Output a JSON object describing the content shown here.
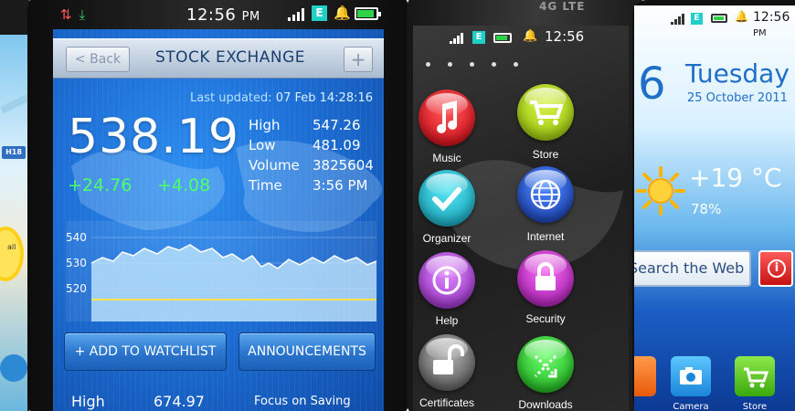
{
  "left_phone": {
    "map_badge": "H18",
    "map_fragment": "all"
  },
  "stock_app": {
    "status": {
      "time": "12:56",
      "period": "PM",
      "network_badge": "E"
    },
    "nav": {
      "back_label": "< Back",
      "title": "STOCK EXCHANGE",
      "add_label": "+"
    },
    "last_updated": {
      "label": "Last updated:",
      "value": "07 Feb 14:28:16"
    },
    "price": "538.19",
    "changes": [
      "+24.76",
      "+4.08"
    ],
    "stats": [
      {
        "key": "High",
        "value": "547.26"
      },
      {
        "key": "Low",
        "value": "481.09"
      },
      {
        "key": "Volume",
        "value": "3825604"
      },
      {
        "key": "Time",
        "value": "3:56 PM"
      }
    ],
    "chart": {
      "y_ticks": [
        "540",
        "530",
        "520"
      ],
      "line_color": "#ffe14a"
    },
    "buttons": {
      "watchlist": "+ ADD TO WATCHLIST",
      "announcements": "ANNOUNCEMENTS"
    },
    "bottom": {
      "high_label": "High",
      "high_value": "674.97",
      "news": "Focus on Saving"
    }
  },
  "icon_phone": {
    "brand": "4G LTE",
    "status": {
      "time": "12:56",
      "network_badge": "E"
    },
    "apps": [
      {
        "label": "Music",
        "icon": "music-note-icon",
        "color": "#e8121e"
      },
      {
        "label": "Store",
        "icon": "shopping-cart-icon",
        "color": "#a9d314"
      },
      {
        "label": "Organizer",
        "icon": "checkmark-icon",
        "color": "#14b9cf"
      },
      {
        "label": "Internet",
        "icon": "globe-icon",
        "color": "#1e5fd8"
      },
      {
        "label": "Help",
        "icon": "info-icon",
        "color": "#b646d8"
      },
      {
        "label": "Security",
        "icon": "padlock-icon",
        "color": "#c828c8"
      },
      {
        "label": "Certificates",
        "icon": "unlocked-padlock-icon",
        "color": "#8a8a8a"
      },
      {
        "label": "Downloads",
        "icon": "download-icon",
        "color": "#2bcf2b"
      }
    ]
  },
  "weather_phone": {
    "status": {
      "time": "12:56",
      "period": "PM",
      "network_badge": "E"
    },
    "day_number": "6",
    "weekday": "Tuesday",
    "full_date": "25 October 2011",
    "temperature": "+19 °C",
    "humidity": "78%",
    "search_placeholder": "Search the Web",
    "info_glyph": "i",
    "dock": [
      {
        "label": "s",
        "color": "#ff6a1a"
      },
      {
        "label": "Camera",
        "color": "#2ba3e8"
      },
      {
        "label": "Store",
        "color": "#5fd42b"
      }
    ]
  }
}
